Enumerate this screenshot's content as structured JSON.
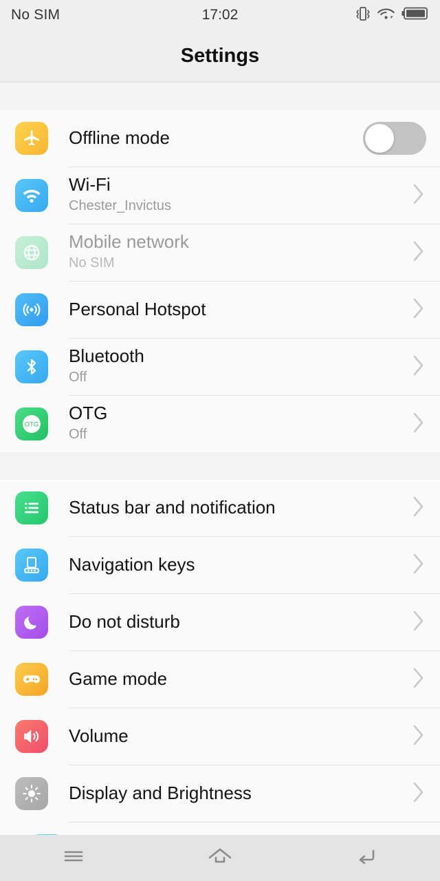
{
  "status_bar": {
    "carrier": "No SIM",
    "time": "17:02",
    "icons": [
      "vibrate-icon",
      "wifi-icon",
      "battery-icon"
    ]
  },
  "header": {
    "title": "Settings"
  },
  "sections": [
    {
      "rows": [
        {
          "label": "Offline mode",
          "sub": "",
          "icon": "airplane-icon",
          "control": "toggle",
          "toggle_on": false,
          "disabled": false
        },
        {
          "label": "Wi-Fi",
          "sub": "Chester_Invictus",
          "icon": "wifi-icon",
          "control": "chevron",
          "disabled": false
        },
        {
          "label": "Mobile network",
          "sub": "No SIM",
          "icon": "globe-icon",
          "control": "chevron",
          "disabled": true
        },
        {
          "label": "Personal Hotspot",
          "sub": "",
          "icon": "hotspot-icon",
          "control": "chevron",
          "disabled": false
        },
        {
          "label": "Bluetooth",
          "sub": "Off",
          "icon": "bluetooth-icon",
          "control": "chevron",
          "disabled": false
        },
        {
          "label": "OTG",
          "sub": "Off",
          "icon": "otg-icon",
          "control": "chevron",
          "disabled": false
        }
      ]
    },
    {
      "rows": [
        {
          "label": "Status bar and notification",
          "sub": "",
          "icon": "notification-list-icon",
          "control": "chevron",
          "disabled": false
        },
        {
          "label": "Navigation keys",
          "sub": "",
          "icon": "navigation-keys-icon",
          "control": "chevron",
          "disabled": false
        },
        {
          "label": "Do not disturb",
          "sub": "",
          "icon": "moon-icon",
          "control": "chevron",
          "disabled": false
        },
        {
          "label": "Game mode",
          "sub": "",
          "icon": "gamepad-icon",
          "control": "chevron",
          "disabled": false
        },
        {
          "label": "Volume",
          "sub": "",
          "icon": "speaker-icon",
          "control": "chevron",
          "disabled": false
        },
        {
          "label": "Display and Brightness",
          "sub": "",
          "icon": "brightness-icon",
          "control": "chevron",
          "disabled": false
        }
      ]
    }
  ],
  "nav_bar": {
    "buttons": [
      {
        "name": "menu-icon"
      },
      {
        "name": "home-icon"
      },
      {
        "name": "back-icon"
      }
    ]
  },
  "colors": {
    "airplane": "#fdc838",
    "wifi": "#45b7f5",
    "globe": "#b9e9cf",
    "hotspot": "#3fa9f5",
    "bluetooth": "#45b7f5",
    "otg": "#33cc70",
    "notification_list": "#33d07a",
    "navigation_keys": "#45b7f5",
    "moon": "#b15cf0",
    "gamepad": "#f5b935",
    "speaker": "#f3626f",
    "brightness": "#b0b0b0",
    "toggle_track": "#c3c3c3",
    "chevron": "#c9c9c9",
    "background": "#f3f3f3",
    "row_background": "#fafafa",
    "header_background": "#efefef"
  }
}
